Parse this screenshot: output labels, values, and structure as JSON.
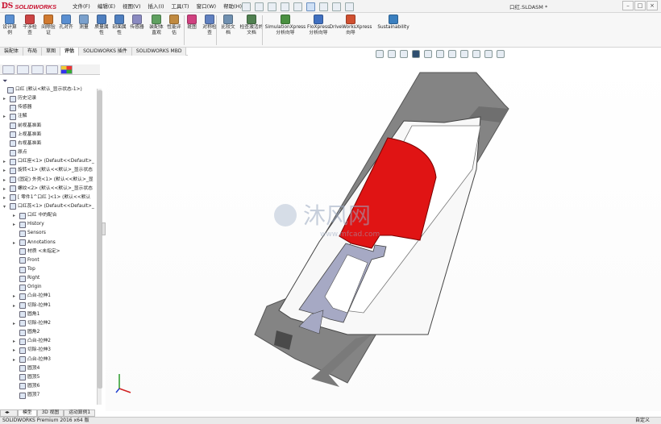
{
  "app": {
    "brand": "SOLIDWORKS",
    "doc_title": "口红.SLDASM *"
  },
  "menus": [
    "文件(F)",
    "编辑(E)",
    "视图(V)",
    "插入(I)",
    "工具(T)",
    "窗口(W)",
    "帮助(H)"
  ],
  "ribbon": [
    {
      "label": "设计算例",
      "color": "#5a8fd1"
    },
    {
      "label": "干涉检查",
      "color": "#cc4444"
    },
    {
      "label": "间隙验证",
      "color": "#d07a30"
    },
    {
      "label": "孔对齐",
      "color": "#5a8fd1"
    },
    {
      "label": "测量",
      "color": "#7aa0cc"
    },
    {
      "label": "质量属性",
      "color": "#4f7fbf"
    },
    {
      "label": "剖面属性",
      "color": "#4f7fbf"
    },
    {
      "label": "传感器",
      "color": "#8a8ac0"
    },
    {
      "label": "装配体直观",
      "color": "#5fa060"
    },
    {
      "label": "性能评估",
      "color": "#c08a40"
    },
    {
      "label": "斑图",
      "color": "#d04080"
    },
    {
      "label": "对称检查",
      "color": "#6080c0"
    },
    {
      "label": "比较文档",
      "color": "#7090b0"
    },
    {
      "label": "检查激活的文档",
      "color": "#508050"
    },
    {
      "label": "SimulationXpress 分析向导",
      "color": "#4a9040"
    },
    {
      "label": "FloXpress 分析向导",
      "color": "#4070c0"
    },
    {
      "label": "DriveWorksXpress 向导",
      "color": "#d05030"
    },
    {
      "label": "Sustainability",
      "color": "#3a7fbf"
    }
  ],
  "tabs": [
    "装配体",
    "布局",
    "草图",
    "评估",
    "SOLIDWORKS 插件",
    "SOLIDWORKS MBD"
  ],
  "active_tab": "评估",
  "tree": [
    {
      "text": "口红 (默认<默认_显示状态-1>)",
      "level": 0,
      "exp": ""
    },
    {
      "text": "历史记录",
      "level": 1,
      "exp": "▸"
    },
    {
      "text": "传感器",
      "level": 1,
      "exp": ""
    },
    {
      "text": "注解",
      "level": 1,
      "exp": "▸"
    },
    {
      "text": "前视基准面",
      "level": 1,
      "exp": ""
    },
    {
      "text": "上视基准面",
      "level": 1,
      "exp": ""
    },
    {
      "text": "右视基准面",
      "level": 1,
      "exp": ""
    },
    {
      "text": "原点",
      "level": 1,
      "exp": ""
    },
    {
      "text": "口红座<1> (Default<<Default>_",
      "level": 1,
      "exp": "▸"
    },
    {
      "text": "旋转<1> (默认<<默认>_显示状态",
      "level": 1,
      "exp": "▸"
    },
    {
      "text": "(固定) 外壳<1> (默认<<默认>_显",
      "level": 1,
      "exp": "▸"
    },
    {
      "text": "螺纹<2> (默认<<默认>_显示状态",
      "level": 1,
      "exp": "▸"
    },
    {
      "text": "[ 零件1^口红 ]<1> (默认<<默认",
      "level": 1,
      "exp": "▸"
    },
    {
      "text": "口红蕊<1> (Default<<Default>_",
      "level": 1,
      "exp": "▾"
    },
    {
      "text": "口红 中的配合",
      "level": 2,
      "exp": "▸"
    },
    {
      "text": "History",
      "level": 2,
      "exp": "▸"
    },
    {
      "text": "Sensors",
      "level": 2,
      "exp": ""
    },
    {
      "text": "Annotations",
      "level": 2,
      "exp": "▸"
    },
    {
      "text": "材质 <未指定>",
      "level": 2,
      "exp": ""
    },
    {
      "text": "Front",
      "level": 2,
      "exp": ""
    },
    {
      "text": "Top",
      "level": 2,
      "exp": ""
    },
    {
      "text": "Right",
      "level": 2,
      "exp": ""
    },
    {
      "text": "Origin",
      "level": 2,
      "exp": ""
    },
    {
      "text": "凸台-拉伸1",
      "level": 2,
      "exp": "▸"
    },
    {
      "text": "切除-拉伸1",
      "level": 2,
      "exp": "▸"
    },
    {
      "text": "圆角1",
      "level": 2,
      "exp": ""
    },
    {
      "text": "切除-拉伸2",
      "level": 2,
      "exp": "▸"
    },
    {
      "text": "圆角2",
      "level": 2,
      "exp": ""
    },
    {
      "text": "凸台-拉伸2",
      "level": 2,
      "exp": "▸"
    },
    {
      "text": "切除-拉伸3",
      "level": 2,
      "exp": "▸"
    },
    {
      "text": "凸台-拉伸3",
      "level": 2,
      "exp": "▸"
    },
    {
      "text": "圆顶4",
      "level": 2,
      "exp": ""
    },
    {
      "text": "圆顶5",
      "level": 2,
      "exp": ""
    },
    {
      "text": "圆顶6",
      "level": 2,
      "exp": ""
    },
    {
      "text": "圆顶7",
      "level": 2,
      "exp": ""
    }
  ],
  "bottom_tabs": [
    "模型",
    "3D 视图",
    "运动算例1"
  ],
  "active_bottom_tab": "模型",
  "status": {
    "left": "SOLIDWORKS Premium 2016 x64 版",
    "right": "自定义"
  },
  "watermark": {
    "cn": "沐风网",
    "url": "www.mfcad.com"
  },
  "colors": {
    "body": "#8a8a8a",
    "cut": "#e01010",
    "core": "#a0a5c2"
  }
}
